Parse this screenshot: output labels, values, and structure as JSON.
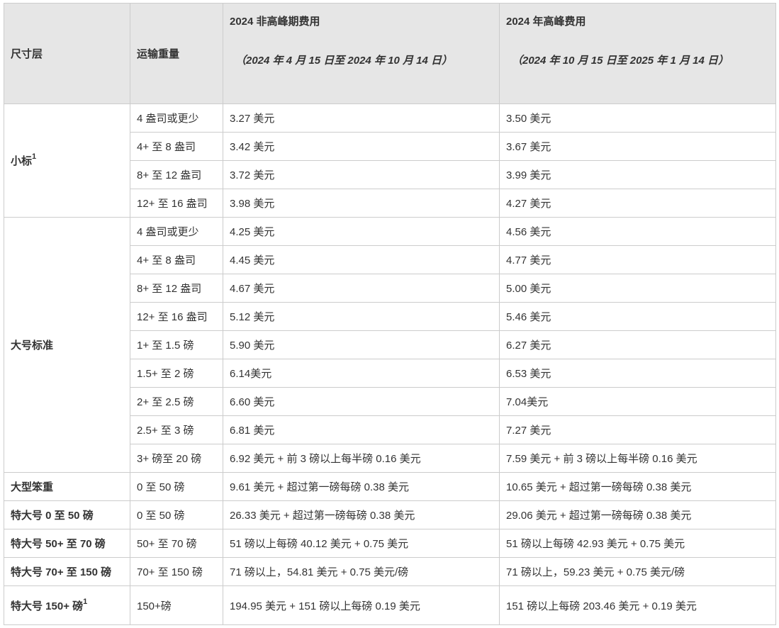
{
  "headers": {
    "tier": "尺寸层",
    "weight": "运输重量",
    "offpeak_title": "2024 非高峰期费用",
    "offpeak_period": "（2024 年 4 月 15 日至 2024 年 10 月 14 日）",
    "peak_title": "2024 年高峰费用",
    "peak_period": "（2024 年 10 月 15 日至 2025 年 1 月 14 日）"
  },
  "groups": [
    {
      "tier": "小标",
      "sup": "1",
      "rows": [
        {
          "weight": "4 盎司或更少",
          "offpeak": "3.27 美元",
          "peak": "3.50 美元"
        },
        {
          "weight": "4+ 至 8 盎司",
          "offpeak": "3.42 美元",
          "peak": "3.67 美元"
        },
        {
          "weight": "8+ 至 12 盎司",
          "offpeak": "3.72 美元",
          "peak": "3.99 美元"
        },
        {
          "weight": "12+ 至 16 盎司",
          "offpeak": "3.98 美元",
          "peak": "4.27 美元"
        }
      ]
    },
    {
      "tier": "大号标准",
      "sup": "",
      "rows": [
        {
          "weight": "4 盎司或更少",
          "offpeak": "4.25 美元",
          "peak": "4.56 美元"
        },
        {
          "weight": "4+ 至 8 盎司",
          "offpeak": "4.45 美元",
          "peak": "4.77 美元"
        },
        {
          "weight": "8+ 至 12 盎司",
          "offpeak": "4.67 美元",
          "peak": "5.00 美元"
        },
        {
          "weight": "12+ 至 16 盎司",
          "offpeak": "5.12 美元",
          "peak": "5.46 美元"
        },
        {
          "weight": "1+ 至 1.5 磅",
          "offpeak": "5.90 美元",
          "peak": "6.27 美元"
        },
        {
          "weight": "1.5+ 至 2 磅",
          "offpeak": "6.14美元",
          "peak": "6.53 美元"
        },
        {
          "weight": "2+ 至 2.5 磅",
          "offpeak": "6.60 美元",
          "peak": "7.04美元"
        },
        {
          "weight": "2.5+ 至 3 磅",
          "offpeak": "6.81 美元",
          "peak": "7.27 美元"
        },
        {
          "weight": "3+ 磅至 20 磅",
          "offpeak": "6.92 美元 + 前 3 磅以上每半磅 0.16 美元",
          "peak": "7.59 美元 + 前 3 磅以上每半磅 0.16 美元"
        }
      ]
    },
    {
      "tier": "大型笨重",
      "sup": "",
      "rows": [
        {
          "weight": "0 至 50 磅",
          "offpeak": "9.61 美元 + 超过第一磅每磅 0.38 美元",
          "peak": "10.65 美元 + 超过第一磅每磅 0.38 美元"
        }
      ]
    },
    {
      "tier": "特大号 0 至 50 磅",
      "sup": "",
      "rows": [
        {
          "weight": "0 至 50 磅",
          "offpeak": "26.33 美元 + 超过第一磅每磅 0.38 美元",
          "peak": "29.06 美元 + 超过第一磅每磅 0.38 美元"
        }
      ]
    },
    {
      "tier": "特大号 50+ 至 70 磅",
      "sup": "",
      "rows": [
        {
          "weight": "50+ 至 70 磅",
          "offpeak": "51 磅以上每磅 40.12 美元 + 0.75 美元",
          "peak": "51 磅以上每磅 42.93 美元 + 0.75 美元"
        }
      ]
    },
    {
      "tier": "特大号 70+ 至 150 磅",
      "sup": "",
      "rows": [
        {
          "weight": "70+ 至 150 磅",
          "offpeak": "71 磅以上，54.81 美元 + 0.75 美元/磅",
          "peak": "71 磅以上，59.23 美元 + 0.75 美元/磅"
        }
      ]
    },
    {
      "tier": "特大号 150+ 磅",
      "sup": "1",
      "rows": [
        {
          "weight": "150+磅",
          "offpeak": "194.95 美元 + 151 磅以上每磅 0.19 美元",
          "peak": "151 磅以上每磅 203.46 美元 + 0.19 美元"
        }
      ]
    }
  ]
}
